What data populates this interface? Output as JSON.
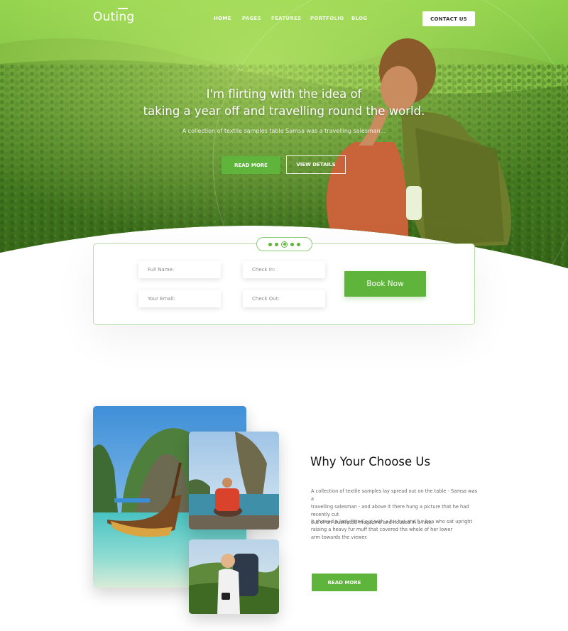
{
  "brand": {
    "name": "Outing"
  },
  "nav": {
    "items": [
      {
        "label": "HOME",
        "active": true
      },
      {
        "label": "PAGES",
        "active": false
      },
      {
        "label": "FEATURES",
        "active": false
      },
      {
        "label": "PORTFOLIO",
        "active": false
      },
      {
        "label": "BLOG",
        "active": false
      }
    ],
    "cta_label": "CONTACT US"
  },
  "hero": {
    "title_line1": "I'm flirting with the idea of",
    "title_line2": "taking a year off and travelling round the world.",
    "subtitle": "A collection of textile samples table Samsa was a travelling salesman...",
    "primary_label": "READ MORE",
    "secondary_label": "VIEW DETAILS",
    "slides_total": 5,
    "slide_active": 3
  },
  "booking": {
    "full_name_placeholder": "Full Name:",
    "email_placeholder": "Your Email:",
    "checkin_placeholder": "Check In:",
    "checkout_placeholder": "Check Out:",
    "submit_label": "Book Now"
  },
  "why": {
    "title": "Why Your Choose Us",
    "para1": [
      "A collection of textile samples lay spread out on the table - Samsa was a",
      "travelling salesman - and above it there hung a picture that he had recently cut",
      "out of an illustrated magazine and housed in a nice."
    ],
    "para2": [
      "It showed a lady fitted out with a fur hat and fur boa who sat upright",
      "raising a heavy fur muff that covered the whole of her lower",
      "arm towards the viewer."
    ],
    "button_label": "READ MORE"
  },
  "colors": {
    "accent": "#5fb53c",
    "hero_overlay": "#6fbe3c",
    "text_dark": "#111111",
    "text_muted": "#666666"
  }
}
